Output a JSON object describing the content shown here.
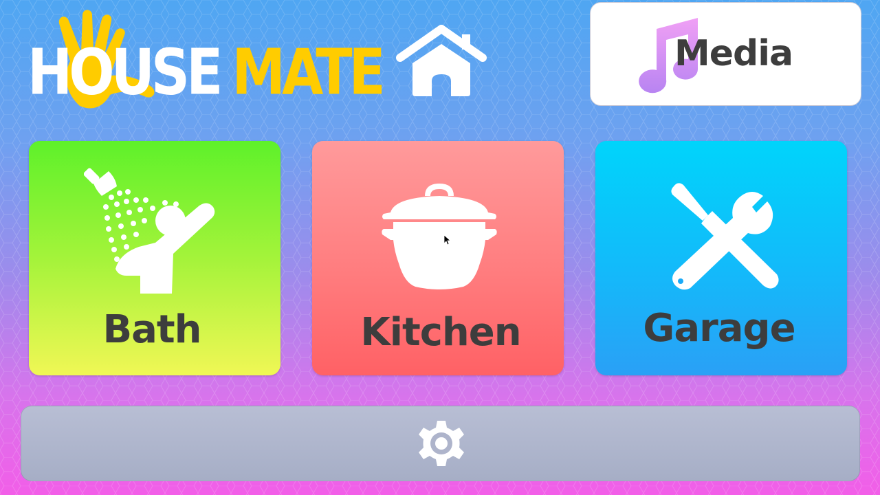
{
  "app": {
    "logo": {
      "word_1": "HOUSE",
      "word_2": "MATE",
      "word_1_color": "#ffffff",
      "word_2_color": "#ffcc00"
    }
  },
  "header": {
    "home_icon": "home-icon",
    "media": {
      "label": "Media",
      "icon": "music-note-icon",
      "icon_color": "#c890f2"
    }
  },
  "tiles": [
    {
      "label": "Bath",
      "icon": "shower-icon",
      "color_top": "#5ef12a",
      "color_bottom": "#f0f755"
    },
    {
      "label": "Kitchen",
      "icon": "cooking-pot-icon",
      "color_top": "#ff9a9b",
      "color_bottom": "#ff6165"
    },
    {
      "label": "Garage",
      "icon": "tools-icon",
      "color_top": "#00d4fb",
      "color_bottom": "#2aa0f6"
    }
  ],
  "footer": {
    "settings_icon": "gear-icon"
  },
  "colors": {
    "label_text": "#3d3d3d",
    "icon_fill": "#ffffff",
    "background_top": "#4fa6f2",
    "background_bottom": "#f25ee8"
  }
}
